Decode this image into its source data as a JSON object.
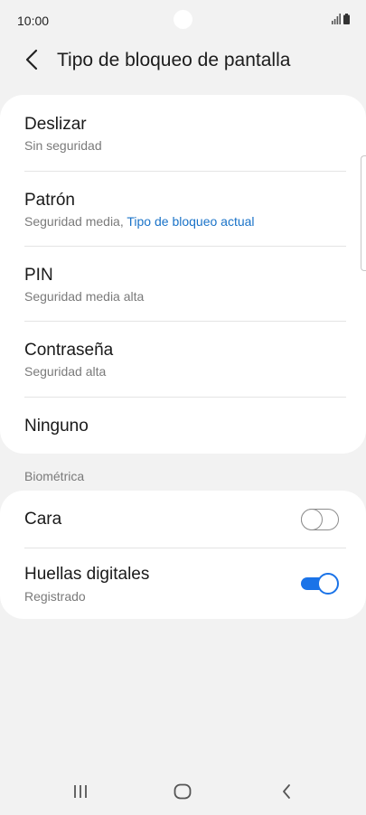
{
  "status_bar": {
    "time": "10:00",
    "icons": [
      "signal-icon",
      "battery-icon"
    ]
  },
  "header": {
    "title": "Tipo de bloqueo de pantalla",
    "back_icon": "chevron-left-icon"
  },
  "lock_types": [
    {
      "title": "Deslizar",
      "subtitle": "Sin seguridad"
    },
    {
      "title": "Patrón",
      "subtitle": "Seguridad media, ",
      "subtitle_highlight": "Tipo de bloqueo actual"
    },
    {
      "title": "PIN",
      "subtitle": "Seguridad media alta"
    },
    {
      "title": "Contraseña",
      "subtitle": "Seguridad alta"
    },
    {
      "title": "Ninguno"
    }
  ],
  "biometrics": {
    "section_label": "Biométrica",
    "items": [
      {
        "title": "Cara",
        "enabled": false
      },
      {
        "title": "Huellas digitales",
        "subtitle": "Registrado",
        "enabled": true
      }
    ]
  },
  "nav_bar": {
    "buttons": [
      "recent-apps-icon",
      "home-icon",
      "back-icon"
    ]
  },
  "colors": {
    "accent": "#1a73e8",
    "link": "#1a73c8",
    "background": "#f2f2f2",
    "card": "#ffffff"
  }
}
